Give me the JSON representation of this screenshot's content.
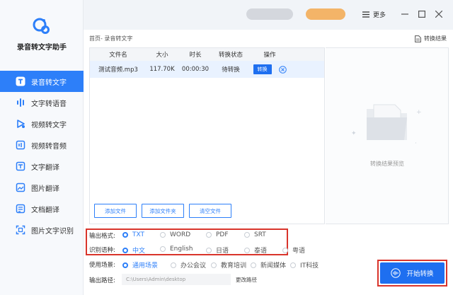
{
  "app": {
    "name": "录音转文字助手"
  },
  "colors": {
    "accent": "#2d7ff9",
    "highlight": "#d9342b"
  },
  "sidebar": {
    "items": [
      {
        "label": "录音转文字",
        "icon": "text-t-icon",
        "active": true
      },
      {
        "label": "文字转语音",
        "icon": "audio-wave-icon",
        "active": false
      },
      {
        "label": "视频转文字",
        "icon": "video-play-icon",
        "active": false
      },
      {
        "label": "视频转音频",
        "icon": "video-audio-icon",
        "active": false
      },
      {
        "label": "文字翻译",
        "icon": "translate-icon",
        "active": false
      },
      {
        "label": "图片翻译",
        "icon": "image-translate-icon",
        "active": false
      },
      {
        "label": "文档翻译",
        "icon": "document-translate-icon",
        "active": false
      },
      {
        "label": "图片文字识别",
        "icon": "ocr-scan-icon",
        "active": false
      }
    ]
  },
  "topbar": {
    "more_label": "更多"
  },
  "breadcrumb": "首页- 录音转文字",
  "result_link": "转换结果",
  "table": {
    "headers": [
      "文件名",
      "大小",
      "时长",
      "转换状态",
      "操作"
    ],
    "rows": [
      {
        "name": "测试音频.mp3",
        "size": "117.70K",
        "duration": "00:00:30",
        "status": "待转换",
        "action": "转换"
      }
    ]
  },
  "panel_buttons": {
    "add_file": "添加文件",
    "add_folder": "添加文件夹",
    "clear": "清空文件"
  },
  "preview": {
    "text": "转换结果预览"
  },
  "options": {
    "format": {
      "label": "输出格式:",
      "choices": [
        "TXT",
        "WORD",
        "PDF",
        "SRT"
      ],
      "selected": "TXT"
    },
    "language": {
      "label": "识别语种:",
      "choices": [
        "中文",
        "English",
        "日语",
        "泰语",
        "粤语"
      ],
      "selected": "中文"
    },
    "scene": {
      "label": "使用场景:",
      "choices": [
        "通用场景",
        "办公会议",
        "教育培训",
        "新闻媒体",
        "IT科技"
      ],
      "selected": "通用场景"
    }
  },
  "output": {
    "label": "输出路径:",
    "path": "C:\\Users\\Admin\\desktop",
    "change_label": "更改路径"
  },
  "start_button": {
    "label": "开始转换"
  }
}
